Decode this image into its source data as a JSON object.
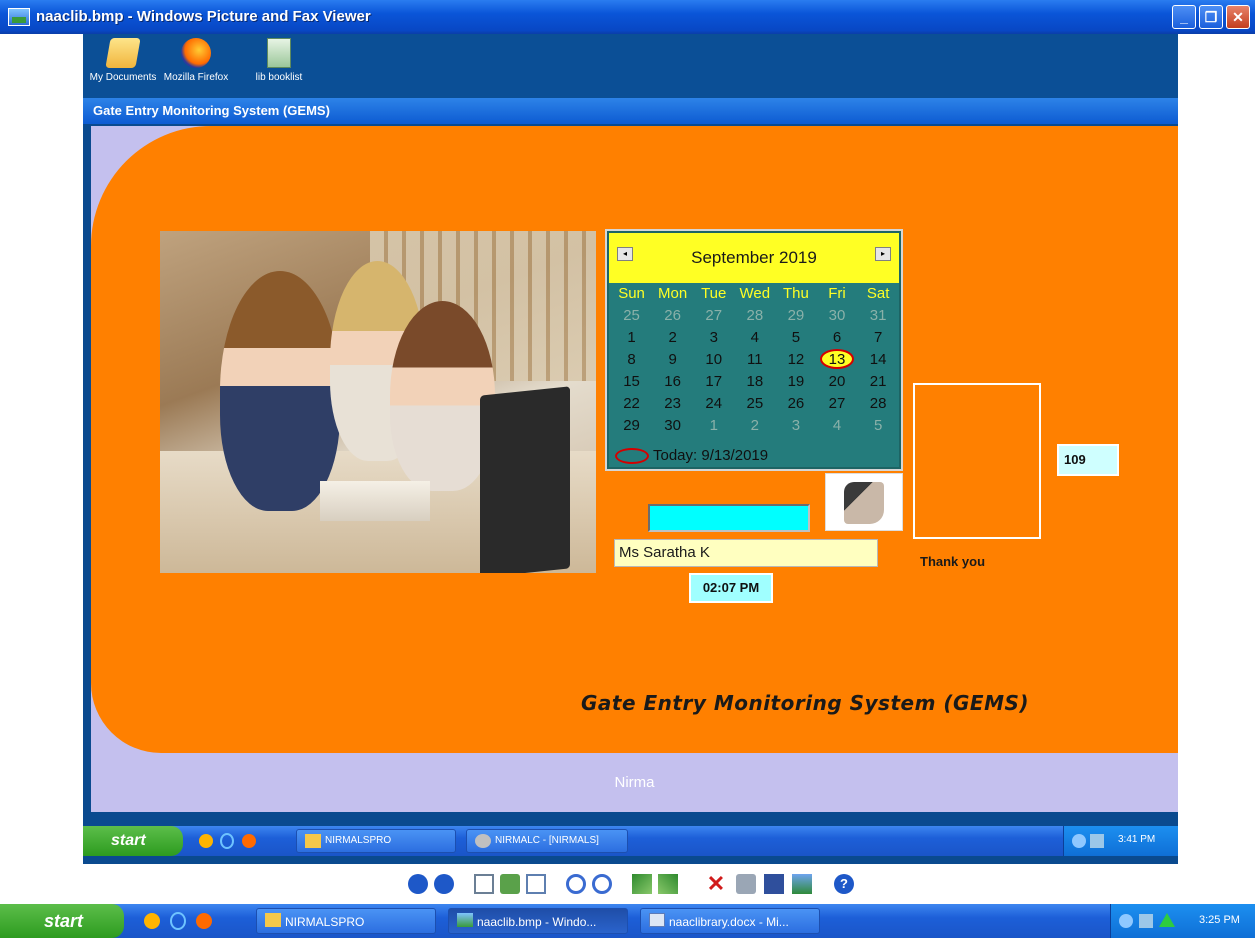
{
  "window": {
    "title": "naaclib.bmp - Windows Picture and Fax Viewer",
    "minimize_label": "_",
    "restore_label": "❐",
    "close_label": "✕"
  },
  "inner_desktop": {
    "icons": [
      {
        "label": "My Documents",
        "icon": "folder-documents-icon"
      },
      {
        "label": "Mozilla Firefox",
        "icon": "firefox-icon"
      },
      {
        "label": "lib booklist",
        "icon": "spreadsheet-icon"
      }
    ]
  },
  "app": {
    "title": "Gate Entry Monitoring System (GEMS)",
    "footer_label": "Gate Entry Monitoring System (GEMS)",
    "institution": "Nirma",
    "name_value": "Ms Saratha K",
    "time_value": "02:07 PM",
    "count_value": "109",
    "thank_you": "Thank you",
    "barcode_value": ""
  },
  "calendar": {
    "month_label": "September 2019",
    "prev_label": "◂",
    "next_label": "▸",
    "weekdays": [
      "Sun",
      "Mon",
      "Tue",
      "Wed",
      "Thu",
      "Fri",
      "Sat"
    ],
    "weeks": [
      [
        "25",
        "26",
        "27",
        "28",
        "29",
        "30",
        "31"
      ],
      [
        "1",
        "2",
        "3",
        "4",
        "5",
        "6",
        "7"
      ],
      [
        "8",
        "9",
        "10",
        "11",
        "12",
        "13",
        "14"
      ],
      [
        "15",
        "16",
        "17",
        "18",
        "19",
        "20",
        "21"
      ],
      [
        "22",
        "23",
        "24",
        "25",
        "26",
        "27",
        "28"
      ],
      [
        "29",
        "30",
        "1",
        "2",
        "3",
        "4",
        "5"
      ]
    ],
    "selected_day": "13",
    "today_label": "Today: 9/13/2019"
  },
  "inner_taskbar": {
    "start_label": "start",
    "buttons": [
      {
        "label": "NIRMALSPRO",
        "icon": "folder-icon"
      },
      {
        "label": "NIRMALC - [NIRMALS]",
        "icon": "app-icon"
      }
    ],
    "clock": "3:41 PM"
  },
  "viewer_toolbar": {
    "tools": [
      "previous-image-icon",
      "next-image-icon",
      "best-fit-icon",
      "actual-size-icon",
      "slideshow-icon",
      "zoom-in-icon",
      "zoom-out-icon",
      "rotate-clockwise-icon",
      "rotate-counterclockwise-icon",
      "delete-icon",
      "print-icon",
      "save-icon",
      "edit-icon",
      "help-icon"
    ]
  },
  "outer_taskbar": {
    "start_label": "start",
    "buttons": [
      {
        "label": "NIRMALSPRO",
        "icon": "folder-icon"
      },
      {
        "label": "naaclib.bmp - Windo...",
        "icon": "picture-viewer-icon"
      },
      {
        "label": "naaclibrary.docx - Mi...",
        "icon": "word-document-icon"
      }
    ],
    "clock": "3:25 PM"
  },
  "colors": {
    "orange_panel": "#ff8000",
    "lavender_background": "#c4c0ee",
    "calendar_teal": "#247c7c",
    "calendar_header_yellow": "#ffff24",
    "barcode_cyan": "#00ffff",
    "name_field_yellow": "#ffffc0"
  }
}
